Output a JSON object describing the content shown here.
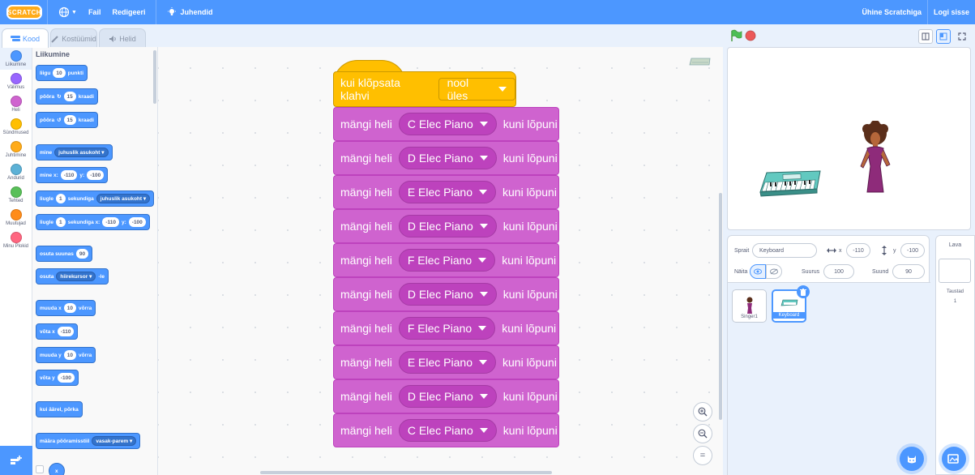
{
  "menubar": {
    "logo": "SCRATCH",
    "file": "Fail",
    "edit": "Redigeeri",
    "tutorials": "Juhendid",
    "share": "Ühine Scratchiga",
    "logout": "Logi sisse",
    "accent_color": "#4c97ff"
  },
  "tabs": [
    {
      "label": "Kood",
      "icon": "code-icon"
    },
    {
      "label": "Kostüümid",
      "icon": "brush-icon"
    },
    {
      "label": "Helid",
      "icon": "speaker-icon"
    }
  ],
  "categories": [
    {
      "label": "Liikumine",
      "color": "#4c97ff"
    },
    {
      "label": "Välimus",
      "color": "#9966ff"
    },
    {
      "label": "Heli",
      "color": "#cf63cf"
    },
    {
      "label": "Sündmused",
      "color": "#ffbf00"
    },
    {
      "label": "Juhtimine",
      "color": "#ffab19"
    },
    {
      "label": "Andurid",
      "color": "#5cb1d6"
    },
    {
      "label": "Tehted",
      "color": "#59c059"
    },
    {
      "label": "Muutujad",
      "color": "#ff8c1a"
    },
    {
      "label": "Minu Plokid",
      "color": "#ff6680"
    }
  ],
  "palette": {
    "title": "Liikumine",
    "move": {
      "a": "liigu",
      "v": "10",
      "b": "punkti"
    },
    "turn_right": {
      "a": "pööra",
      "v": "15",
      "b": "kraadi"
    },
    "turn_left": {
      "a": "pööra",
      "v": "15",
      "b": "kraadi"
    },
    "goto": {
      "a": "mine",
      "d": "juhuslik asukoht"
    },
    "goto_xy": {
      "a": "mine x:",
      "x": "-110",
      "b": "y:",
      "y": "-100"
    },
    "glide": {
      "a": "liugle",
      "v": "1",
      "b": "sekundiga",
      "d": "juhuslik asukoht"
    },
    "glide_xy": {
      "a": "liugle",
      "v": "1",
      "b": "sekundiga x:",
      "x": "-110",
      "c": "y:",
      "y": "-100"
    },
    "point_dir": {
      "a": "osuta suunas",
      "v": "90"
    },
    "point_towards": {
      "a": "osuta",
      "d": "hiirekursor",
      "b": "-le"
    },
    "change_x": {
      "a": "muuda x",
      "v": "10",
      "b": "võrra"
    },
    "set_x": {
      "a": "võta x",
      "v": "-110"
    },
    "change_y": {
      "a": "muuda y",
      "v": "10",
      "b": "võrra"
    },
    "set_y": {
      "a": "võta y",
      "v": "-100"
    },
    "bounce": "kui äärel, põrka",
    "rotation": {
      "a": "määra pööramisstiil",
      "d": "vasak-parem"
    },
    "xpos": "x"
  },
  "script": {
    "hat": {
      "text": "kui klõpsata klahvi",
      "key": "nool üles"
    },
    "play_prefix": "mängi heli",
    "play_suffix": "kuni lõpuni",
    "sounds": [
      "C Elec Piano",
      "D Elec Piano",
      "E Elec Piano",
      "D Elec Piano",
      "F Elec Piano",
      "D Elec Piano",
      "F Elec Piano",
      "E Elec Piano",
      "D Elec Piano",
      "C Elec Piano"
    ]
  },
  "zoom": {
    "in": "+",
    "out": "−",
    "reset": "="
  },
  "sprite_info": {
    "sprite_label": "Sprait",
    "sprite_name": "Keyboard",
    "x_label": "x",
    "x_value": "-110",
    "y_label": "y",
    "y_value": "-100",
    "show_label": "Näita",
    "size_label": "Suurus",
    "size_value": "100",
    "direction_label": "Suund",
    "direction_value": "90"
  },
  "sprites": [
    {
      "name": "Singer1",
      "selected": false
    },
    {
      "name": "Keyboard",
      "selected": true
    }
  ],
  "stage_target": {
    "title": "Lava",
    "backdrops_label": "Taustad",
    "backdrops_count": "1"
  }
}
